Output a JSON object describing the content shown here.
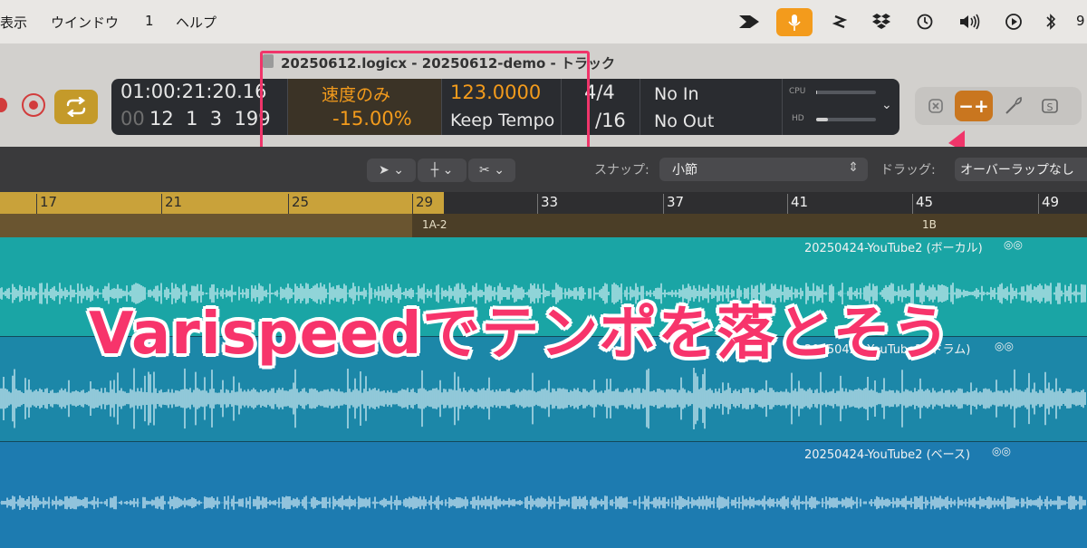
{
  "menubar": {
    "items": [
      "表示",
      "ウインドウ",
      "1",
      "ヘルプ"
    ],
    "status_icons": [
      "scrivener-icon",
      "microphone-icon",
      "bolt-icon",
      "dropbox-icon",
      "time-machine-icon",
      "volume-icon",
      "play-circle-icon",
      "bluetooth-icon"
    ],
    "clock_partial": "9"
  },
  "window": {
    "title": "20250612.logicx - 20250612-demo - トラック"
  },
  "lcd": {
    "time": "01:00:21:20.16",
    "bars_prefix": "00",
    "bars": "12  1  3  199",
    "varispeed_mode": "速度のみ",
    "varispeed_value": "-15.00%",
    "tempo": "123.0000",
    "tempo_mode": "Keep Tempo",
    "signature": "4/4",
    "division": "/16",
    "midi_in": "No In",
    "midi_out": "No Out",
    "cpu_label": "CPU",
    "hd_label": "HD",
    "cpu_level": 0.02,
    "hd_level": 0.2
  },
  "toolbar": {
    "varispeed_button": "−+",
    "colors": {
      "accent": "#c9761f",
      "highlight": "#f0356a"
    }
  },
  "tools": {
    "snap_label": "スナップ:",
    "snap_value": "小節",
    "drag_label": "ドラッグ:",
    "drag_value": "オーバーラップなし"
  },
  "ruler": {
    "bars": [
      "17",
      "21",
      "25",
      "29",
      "33",
      "37",
      "41",
      "45",
      "49"
    ],
    "markers": [
      "1A-2",
      "1B"
    ]
  },
  "tracks": [
    {
      "region": "20250424-YouTube2 (ボーカル)"
    },
    {
      "region": "20250424-YouTube2 (ドラム)"
    },
    {
      "region": "20250424-YouTube2 (ベース)"
    }
  ],
  "overlay": {
    "caption": "Varispeedでテンポを落とそう"
  }
}
